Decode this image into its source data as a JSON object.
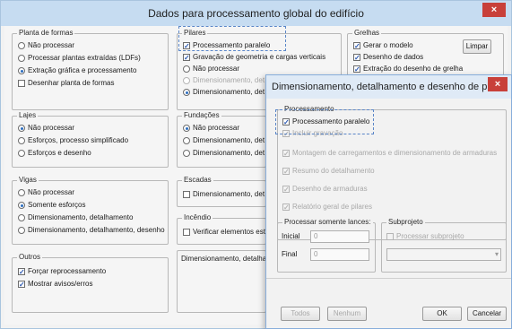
{
  "main": {
    "title": "Dados para processamento global do edifício",
    "close": "×",
    "planta": {
      "title": "Planta de formas",
      "options": [
        "Não processar",
        "Processar plantas extraídas (LDFs)",
        "Extração gráfica e processamento"
      ],
      "check": "Desenhar planta de formas"
    },
    "pilares": {
      "title": "Pilares",
      "check1": "Processamento paralelo",
      "check2": "Gravação de geometria e cargas verticais",
      "options": [
        "Não processar",
        "Dimensionamento, det",
        "Dimensionamento, det"
      ]
    },
    "grelhas": {
      "title": "Grelhas",
      "checks": [
        "Gerar o modelo",
        "Desenho de dados",
        "Extração do desenho de grelha"
      ],
      "limpar": "Limpar"
    },
    "lajes": {
      "title": "Lajes",
      "options": [
        "Não processar",
        "Esforços, processo simplificado",
        "Esforços e desenho"
      ]
    },
    "fundacoes": {
      "title": "Fundações",
      "options": [
        "Não processar",
        "Dimensionamento, det",
        "Dimensionamento, det"
      ]
    },
    "vigas": {
      "title": "Vigas",
      "options": [
        "Não processar",
        "Somente esforços",
        "Dimensionamento, detalhamento",
        "Dimensionamento, detalhamento, desenho"
      ]
    },
    "escadas": {
      "title": "Escadas",
      "check": "Dimensionamento, det"
    },
    "incendio": {
      "title": "Incêndio",
      "check": "Verificar elementos est"
    },
    "outros": {
      "title": "Outros",
      "checks": [
        "Forçar reprocessamento",
        "Mostrar avisos/erros"
      ]
    },
    "dimensionamento_label": "Dimensionamento, detalham"
  },
  "sub": {
    "title": "Dimensionamento, detalhamento e desenho de pi...",
    "close": "×",
    "processamento": {
      "title": "Processamento",
      "checks": [
        "Processamento paralelo",
        "Incluir gravação",
        "Montagem de carregamentos e dimensionamento de armaduras",
        "Resumo do detalhamento",
        "Desenho de armaduras",
        "Relatório geral de pilares"
      ]
    },
    "lances": {
      "title": "Processar somente lances:",
      "inicial_label": "Inicial",
      "inicial": "0",
      "final_label": "Final",
      "final": "0"
    },
    "subprojeto": {
      "title": "Subprojeto",
      "check": "Processar subprojeto"
    },
    "buttons": {
      "todos": "Todos",
      "nenhum": "Nenhum",
      "ok": "OK",
      "cancelar": "Cancelar"
    }
  }
}
